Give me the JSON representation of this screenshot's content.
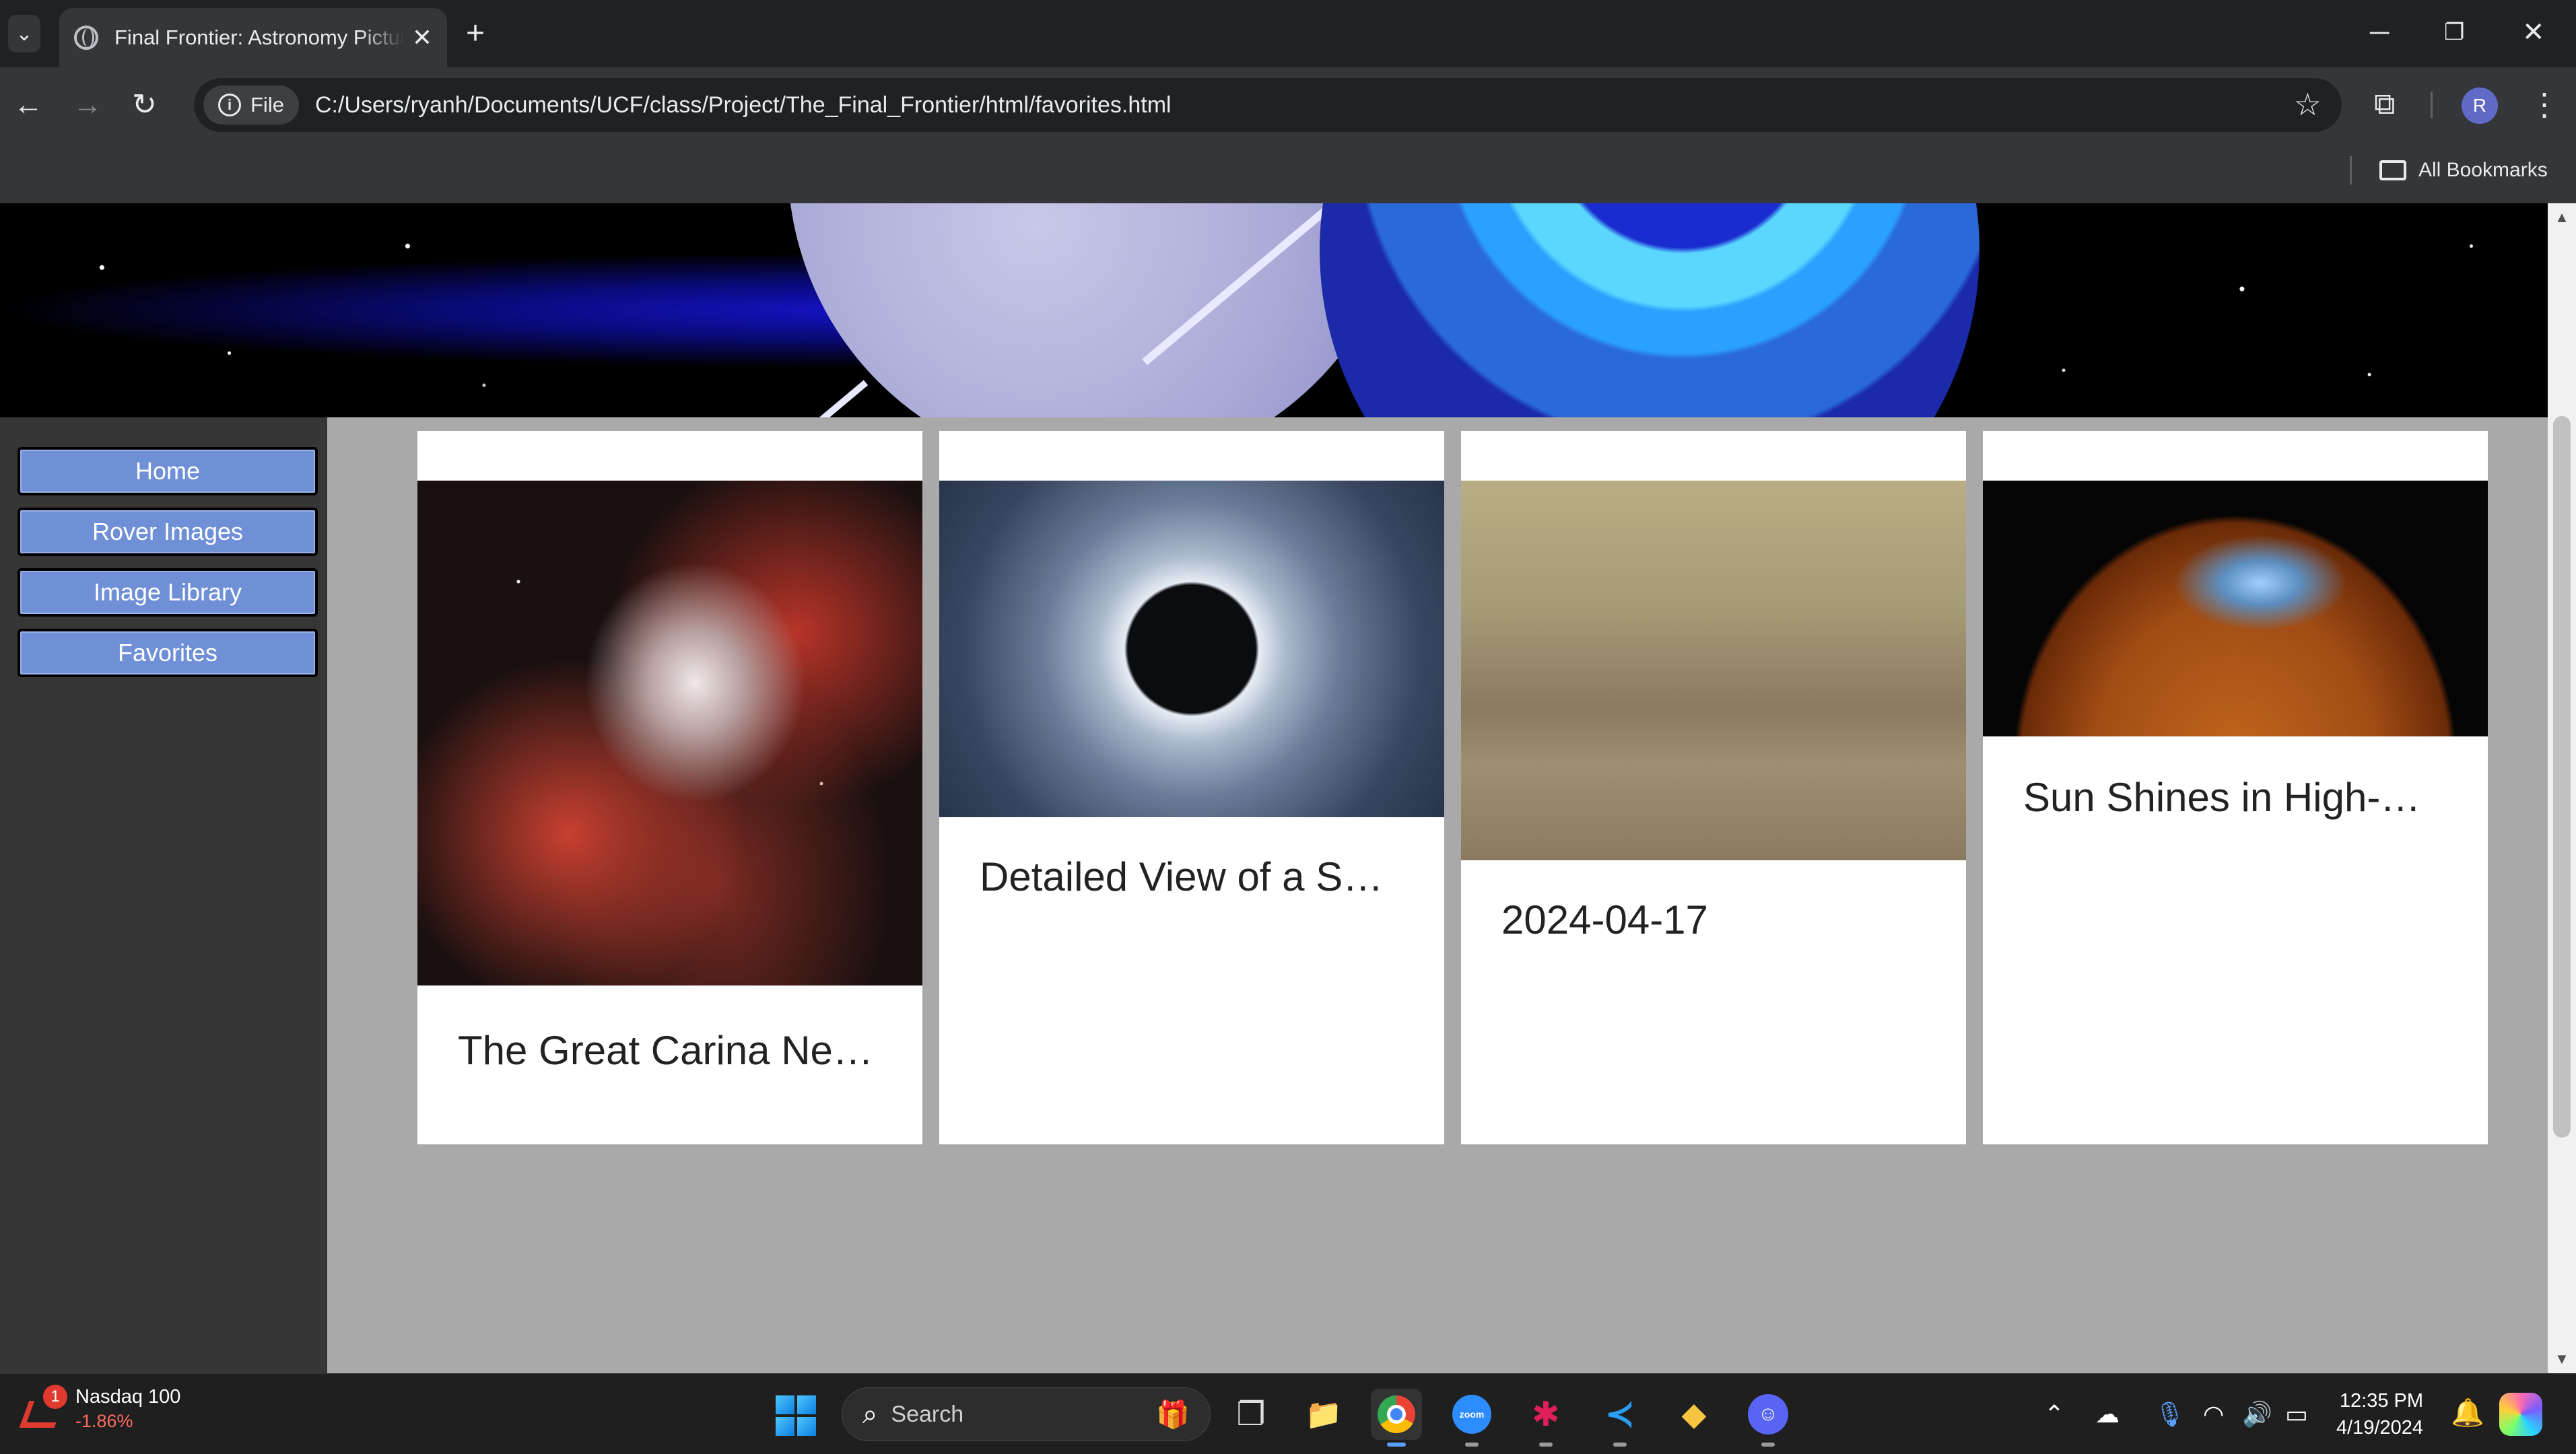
{
  "browser": {
    "tab_title": "Final Frontier: Astronomy Picture of the Day",
    "tab_close": "✕",
    "new_tab": "+",
    "address_chip": "File",
    "url": "C:/Users/ryanh/Documents/UCF/class/Project/The_Final_Frontier/html/favorites.html",
    "profile_initial": "R",
    "bookmarks_label": "All Bookmarks"
  },
  "sidebar": {
    "items": [
      {
        "label": "Home"
      },
      {
        "label": "Rover Images"
      },
      {
        "label": "Image Library"
      },
      {
        "label": "Favorites"
      }
    ]
  },
  "cards": [
    {
      "caption": "The Great Carina Ne…",
      "image": "carina-nebula"
    },
    {
      "caption": "Detailed View of a S…",
      "image": "solar-eclipse-corona"
    },
    {
      "caption": "2024-04-17",
      "image": "mars-rover-terrain"
    },
    {
      "caption": "Sun Shines in High-…",
      "image": "sun-xray"
    }
  ],
  "taskbar": {
    "widget_name": "Nasdaq 100",
    "widget_value": "-1.86%",
    "widget_badge": "1",
    "search_placeholder": "Search",
    "zoom_label": "zoom",
    "time": "12:35 PM",
    "date": "4/19/2024"
  },
  "colors": {
    "nav_button": "#6f8fd6",
    "sidebar_bg": "#363636",
    "content_bg": "#a9a9a9",
    "card_bg": "#ffffff"
  }
}
